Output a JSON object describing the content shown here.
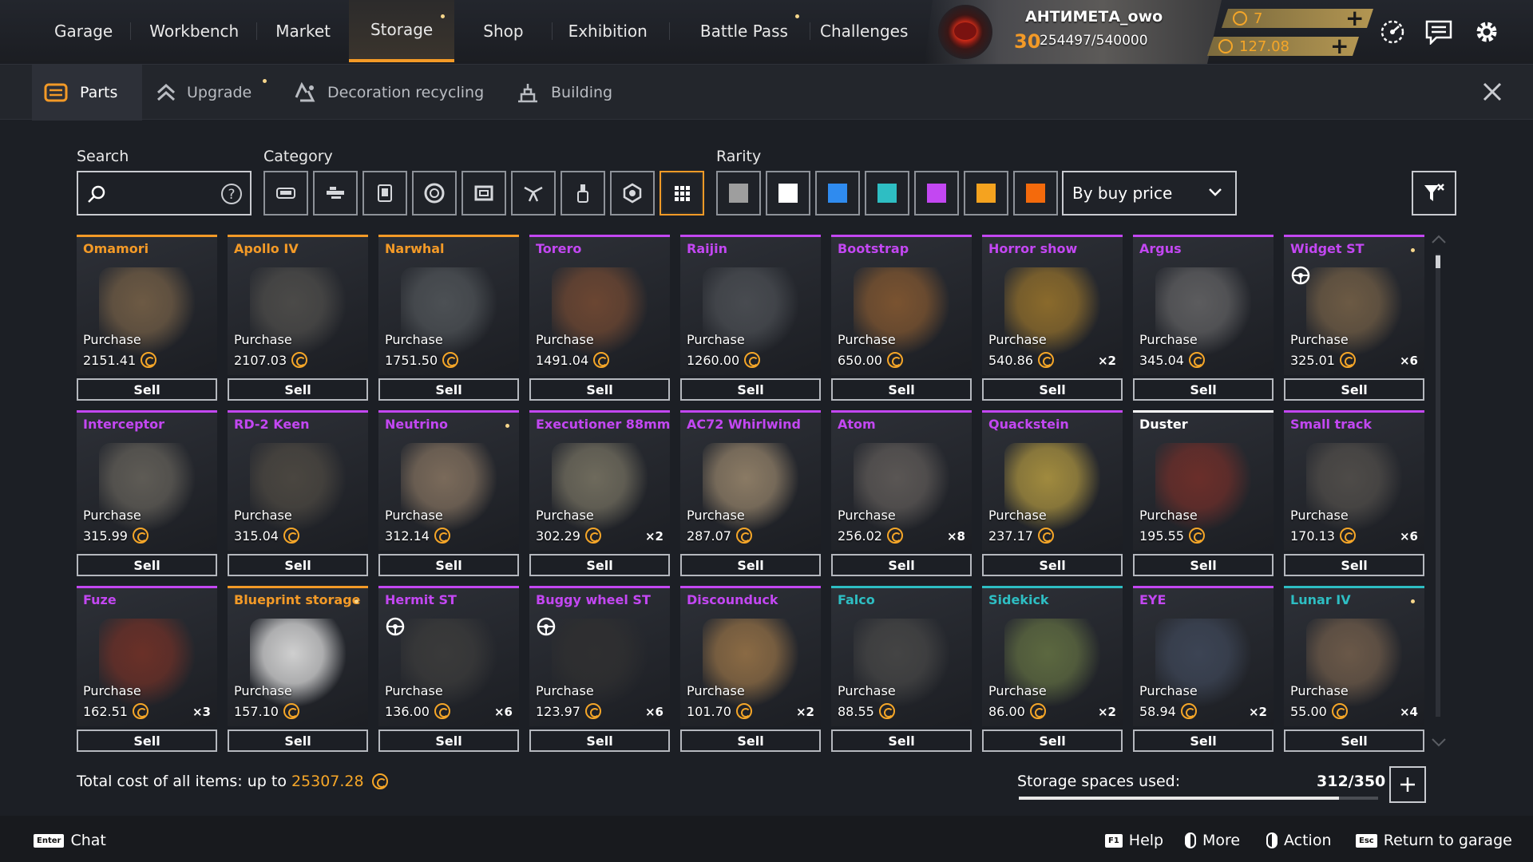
{
  "nav": {
    "items": [
      {
        "label": "Garage"
      },
      {
        "label": "Workbench"
      },
      {
        "label": "Market"
      },
      {
        "label": "Storage",
        "active": true,
        "notify": true
      },
      {
        "label": "Shop"
      },
      {
        "label": "Exhibition"
      },
      {
        "label": "Battle Pass",
        "notify": true
      },
      {
        "label": "Challenges"
      }
    ]
  },
  "profile": {
    "name": "АНТИМЕТА_owo",
    "level": "30",
    "xp": "254497/540000",
    "currency1": "7",
    "currency2": "127.08"
  },
  "subtabs": [
    {
      "label": "Parts",
      "icon": "parts-icon",
      "active": true
    },
    {
      "label": "Upgrade",
      "icon": "upgrade-icon",
      "notify": true
    },
    {
      "label": "Decoration recycling",
      "icon": "recycle-icon"
    },
    {
      "label": "Building",
      "icon": "building-icon"
    }
  ],
  "filters": {
    "search_label": "Search",
    "category_label": "Category",
    "rarity_label": "Rarity",
    "categories": [
      "cabin-icon",
      "weapon-icon",
      "module-icon",
      "wheel-icon",
      "frame-icon",
      "decor-icon",
      "paint-icon",
      "hexagon-icon",
      "all-grid-icon"
    ],
    "rarities": [
      "#9e9e9e",
      "#ffffff",
      "#2f8bef",
      "#2ebec3",
      "#c347f2",
      "#f5a31f",
      "#f46a0c"
    ],
    "sort": "By buy price"
  },
  "labels": {
    "purchase": "Purchase",
    "sell": "Sell"
  },
  "items": [
    {
      "name": "Omamori",
      "price": "2151.41",
      "qty": "",
      "color": "#f39a27",
      "obj": "#6d5a44"
    },
    {
      "name": "Apollo IV",
      "price": "2107.03",
      "qty": "",
      "color": "#f39a27",
      "obj": "#4b4a48"
    },
    {
      "name": "Narwhal",
      "price": "1751.50",
      "qty": "",
      "color": "#f39a27",
      "obj": "#4c5054"
    },
    {
      "name": "Torero",
      "price": "1491.04",
      "qty": "",
      "color": "#c347f2",
      "obj": "#6b4632"
    },
    {
      "name": "Raijin",
      "price": "1260.00",
      "qty": "",
      "color": "#c347f2",
      "obj": "#484b50"
    },
    {
      "name": "Bootstrap",
      "price": "650.00",
      "qty": "",
      "color": "#c347f2",
      "obj": "#7a5330"
    },
    {
      "name": "Horror show",
      "price": "540.86",
      "qty": "×2",
      "color": "#c347f2",
      "obj": "#8a6a2c"
    },
    {
      "name": "Argus",
      "price": "345.04",
      "qty": "",
      "color": "#c347f2",
      "obj": "#5c5c5e"
    },
    {
      "name": "Widget ST",
      "price": "325.01",
      "qty": "×6",
      "color": "#c347f2",
      "obj": "#6c5a44",
      "dot": true,
      "wheel": true
    },
    {
      "name": "Interceptor",
      "price": "315.99",
      "qty": "",
      "color": "#c347f2",
      "obj": "#5e5b55"
    },
    {
      "name": "RD-2 Keen",
      "price": "315.04",
      "qty": "",
      "color": "#c347f2",
      "obj": "#4a4640"
    },
    {
      "name": "Neutrino",
      "price": "312.14",
      "qty": "",
      "color": "#c347f2",
      "obj": "#7a6a5a",
      "dot": true
    },
    {
      "name": "Executioner 88mm",
      "price": "302.29",
      "qty": "×2",
      "color": "#c347f2",
      "obj": "#6e6a5c"
    },
    {
      "name": "AC72 Whirlwind",
      "price": "287.07",
      "qty": "",
      "color": "#c347f2",
      "obj": "#8a7a64"
    },
    {
      "name": "Atom",
      "price": "256.02",
      "qty": "×8",
      "color": "#c347f2",
      "obj": "#5a5654"
    },
    {
      "name": "Quackstein",
      "price": "237.17",
      "qty": "",
      "color": "#c347f2",
      "obj": "#a08a3e"
    },
    {
      "name": "Duster",
      "price": "195.55",
      "qty": "",
      "color": "#ffffff",
      "obj": "#6a2e2a"
    },
    {
      "name": "Small track",
      "price": "170.13",
      "qty": "×6",
      "color": "#c347f2",
      "obj": "#4e4b48"
    },
    {
      "name": "Fuze",
      "price": "162.51",
      "qty": "×3",
      "color": "#c347f2",
      "obj": "#6a3028"
    },
    {
      "name": "Blueprint storage",
      "price": "157.10",
      "qty": "",
      "color": "#f39a27",
      "obj": "#cfcfcf",
      "dot": true
    },
    {
      "name": "Hermit ST",
      "price": "136.00",
      "qty": "×6",
      "color": "#c347f2",
      "obj": "#3a3a3a",
      "wheel": true
    },
    {
      "name": "Buggy wheel ST",
      "price": "123.97",
      "qty": "×6",
      "color": "#c347f2",
      "obj": "#2f2f30",
      "wheel": true
    },
    {
      "name": "Discounduck",
      "price": "101.70",
      "qty": "×2",
      "color": "#c347f2",
      "obj": "#8a6a44"
    },
    {
      "name": "Falco",
      "price": "88.55",
      "qty": "",
      "color": "#2ebec3",
      "obj": "#444444"
    },
    {
      "name": "Sidekick",
      "price": "86.00",
      "qty": "×2",
      "color": "#2ebec3",
      "obj": "#5c6840"
    },
    {
      "name": "EYE",
      "price": "58.94",
      "qty": "×2",
      "color": "#c347f2",
      "obj": "#3c4454"
    },
    {
      "name": "Lunar IV",
      "price": "55.00",
      "qty": "×4",
      "color": "#2ebec3",
      "obj": "#6a5848",
      "dot": true
    }
  ],
  "summary": {
    "total_label": "Total cost of all items: up to",
    "total_value": "25307.28",
    "storage_label": "Storage spaces used:",
    "storage_value": "312/350",
    "storage_fraction": 0.891
  },
  "footer": [
    {
      "key": "Enter",
      "label": "Chat"
    },
    {
      "key": "F1",
      "label": "Help"
    },
    {
      "mouse": "left",
      "label": "More"
    },
    {
      "mouse": "right",
      "label": "Action"
    },
    {
      "key": "Esc",
      "label": "Return to garage"
    }
  ]
}
